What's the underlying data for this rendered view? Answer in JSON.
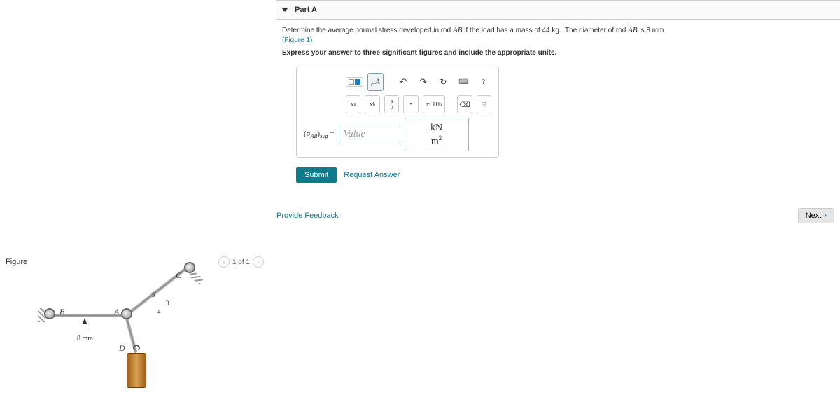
{
  "part": {
    "label": "Part A"
  },
  "prompt": {
    "line1_pre": "Determine the average normal stress developed in rod ",
    "rod_span1": "AB",
    "line1_mid": " if the load has a mass of ",
    "mass": "44 kg",
    "line1_mid2": " . The diameter of rod ",
    "rod_span2": "AB",
    "line1_end": " is ",
    "diameter": "8 mm.",
    "figure_link": "(Figure 1)",
    "instruction": "Express your answer to three significant figures and include the appropriate units."
  },
  "toolbar": {
    "templates": "",
    "mu": "µÅ",
    "xa": "xᵃ",
    "xb": "xᵦ",
    "ab": "a/b",
    "dot": "•",
    "sci": "x·10ⁿ",
    "clear": "",
    "help": "?",
    "undo": "↶",
    "redo": "↷",
    "reset": "↻",
    "keyboard": "⌨"
  },
  "answer": {
    "lhs": "(σ_AB)avg =",
    "lhs_pre": "(σ",
    "lhs_sub": "AB",
    "lhs_post": ")",
    "lhs_sub2": "avg",
    "lhs_eq": " =",
    "placeholder": "Value",
    "unit_top": "kN",
    "unit_bot": "m",
    "unit_bot_exp": "2"
  },
  "actions": {
    "submit": "Submit",
    "request": "Request Answer",
    "feedback": "Provide Feedback",
    "next": "Next"
  },
  "figure": {
    "title": "Figure",
    "counter": "1 of 1",
    "labels": {
      "A": "A",
      "B": "B",
      "C": "C",
      "D": "D",
      "dim": "8 mm",
      "five": "5",
      "three": "3",
      "four": "4"
    }
  }
}
